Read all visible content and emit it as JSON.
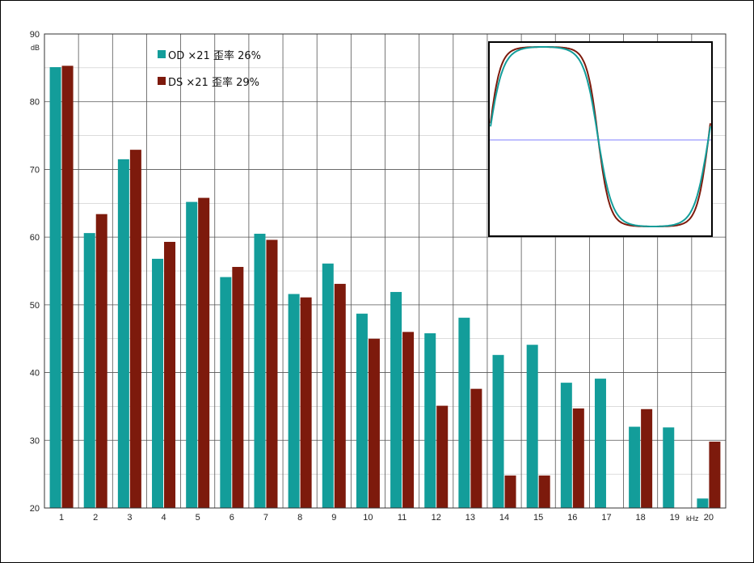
{
  "chart_data": {
    "type": "bar",
    "ylim": [
      20,
      90
    ],
    "ylabel": "dB",
    "xlabel": "kHz",
    "grid": true,
    "legend_placement": "top-left",
    "categories": [
      "1",
      "2",
      "3",
      "4",
      "5",
      "6",
      "7",
      "8",
      "9",
      "10",
      "11",
      "12",
      "13",
      "14",
      "15",
      "16",
      "17",
      "18",
      "19",
      "20"
    ],
    "series": [
      {
        "name": "OD ×21 歪率 26%",
        "color": "#139d9a",
        "values": [
          85.1,
          60.6,
          71.5,
          56.8,
          65.2,
          54.1,
          60.5,
          51.6,
          56.1,
          48.7,
          51.9,
          45.8,
          48.1,
          42.6,
          44.1,
          38.5,
          39.1,
          32.0,
          31.9,
          21.4
        ]
      },
      {
        "name": "DS ×21 歪率 29%",
        "color": "#7d1a0c",
        "values": [
          85.3,
          63.4,
          72.9,
          59.3,
          65.8,
          55.6,
          59.6,
          51.1,
          53.1,
          45.0,
          46.0,
          35.1,
          37.6,
          24.8,
          24.8,
          34.7,
          null,
          34.6,
          null,
          29.8
        ]
      }
    ],
    "inset": {
      "type": "line",
      "description_colors": {
        "od": "#139d9a",
        "ds": "#7d1a0c",
        "zero_line": "#9999ff"
      },
      "waveforms": [
        "OD",
        "DS"
      ]
    }
  }
}
